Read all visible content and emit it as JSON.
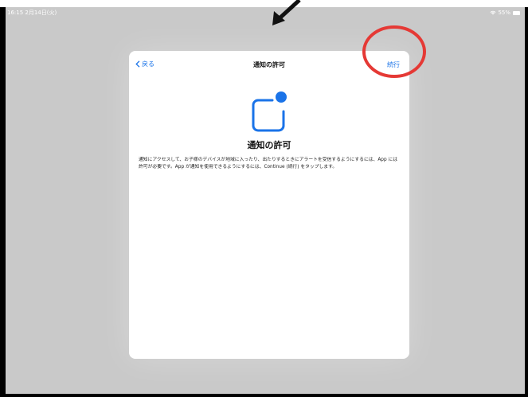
{
  "status_bar": {
    "time_date": "16:15 2月14日(火)",
    "battery_percent": "55%"
  },
  "modal": {
    "back_label": "戻る",
    "title": "通知の許可",
    "continue_label": "続行"
  },
  "content": {
    "title": "通知の許可",
    "body": "通知にアクセスして、お子様のデバイスが地域に入ったり、出たりするときにアラートを受信するようにするには、App には許可が必要です。App が通知を使用できるようにするには、Continue (続行) をタップします。"
  },
  "icons": {
    "notification": "notification-badge-icon",
    "back": "chevron-left-icon",
    "wifi": "wifi-icon",
    "battery": "battery-icon"
  },
  "colors": {
    "accent": "#1a73e8",
    "annotation": "#e53935",
    "screen_background": "#c9c9c9"
  }
}
